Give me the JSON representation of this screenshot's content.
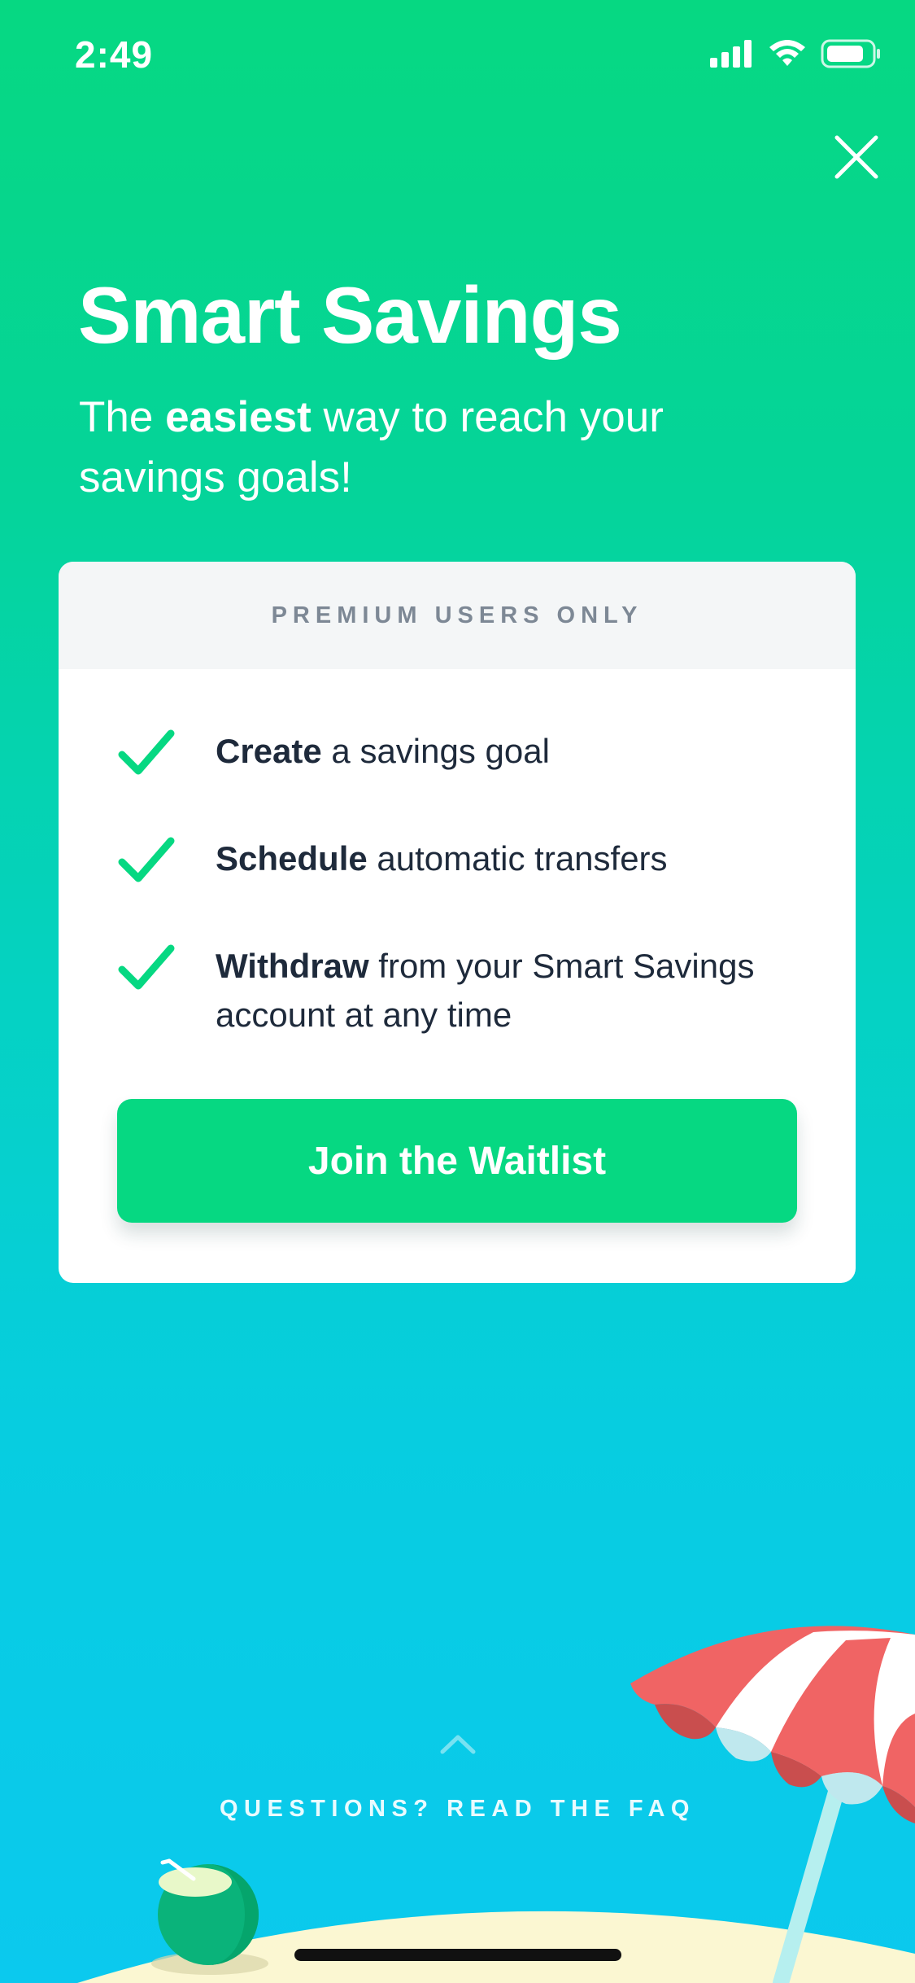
{
  "status_bar": {
    "time": "2:49",
    "icons": [
      "signal-icon",
      "wifi-icon",
      "battery-icon"
    ]
  },
  "header": {
    "close_icon": "close-icon",
    "title": "Smart Savings",
    "subtitle_before": "The ",
    "subtitle_bold": "easiest",
    "subtitle_after": " way to reach your savings goals!"
  },
  "card": {
    "header_label": "PREMIUM USERS ONLY",
    "features": [
      {
        "bold": "Create",
        "rest": " a savings goal",
        "icon": "check-icon"
      },
      {
        "bold": "Schedule",
        "rest": " automatic transfers",
        "icon": "check-icon"
      },
      {
        "bold": "Withdraw",
        "rest": " from your Smart Savings account at any time",
        "icon": "check-icon"
      }
    ],
    "button_label": "Join the Waitlist"
  },
  "footer": {
    "chevron_icon": "chevron-up-icon",
    "faq_label": "QUESTIONS? READ THE FAQ"
  },
  "colors": {
    "brand_green": "#06d882",
    "gradient_top": "#06d882",
    "gradient_bottom": "#0bc9ee",
    "card_text": "#1e2a3b",
    "card_header_text": "#7d8895"
  }
}
